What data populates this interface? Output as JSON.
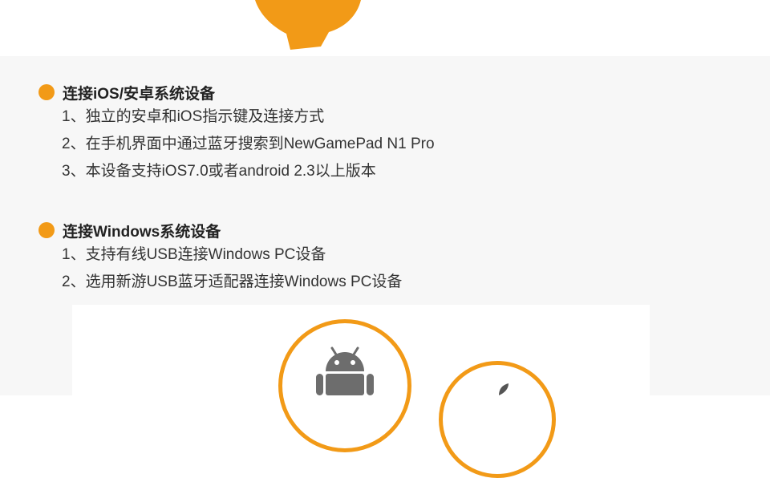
{
  "colors": {
    "accent": "#f29a17",
    "background": "#f7f7f7",
    "text": "#333333"
  },
  "section_ios_android": {
    "title": "连接iOS/安卓系统设备",
    "items": [
      "1、独立的安卓和iOS指示键及连接方式",
      "2、在手机界面中通过蓝牙搜索到NewGamePad N1 Pro",
      "3、本设备支持iOS7.0或者android 2.3以上版本"
    ]
  },
  "section_windows": {
    "title": "连接Windows系统设备",
    "items": [
      "1、支持有线USB连接Windows PC设备",
      "2、选用新游USB蓝牙适配器连接Windows PC设备"
    ]
  },
  "icons": {
    "android": "android-icon",
    "apple": "apple-icon"
  }
}
